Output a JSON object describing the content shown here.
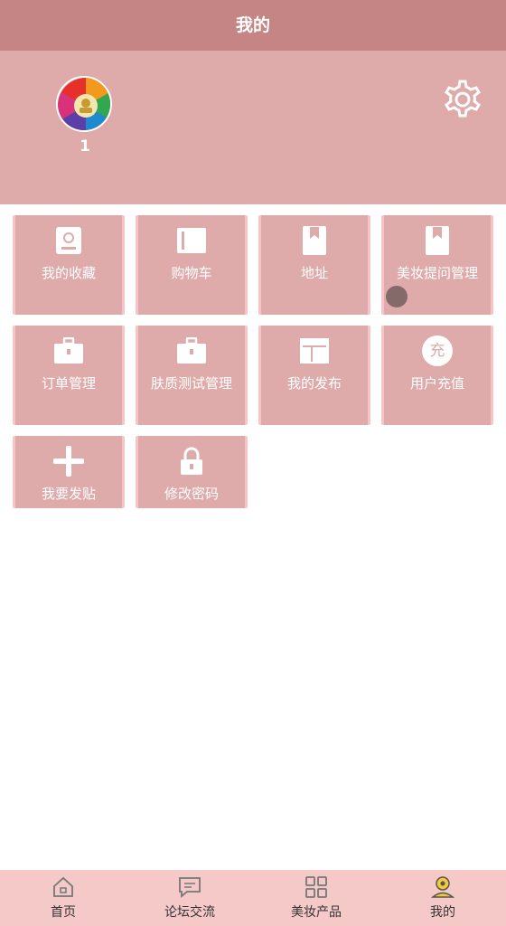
{
  "header": {
    "title": "我的"
  },
  "profile": {
    "username": "1"
  },
  "menu": [
    {
      "label": "我的收藏",
      "icon": "id-card-icon"
    },
    {
      "label": "购物车",
      "icon": "cart-icon"
    },
    {
      "label": "地址",
      "icon": "bookmark-icon"
    },
    {
      "label": "美妆提问管理",
      "icon": "bookmark-icon"
    },
    {
      "label": "订单管理",
      "icon": "briefcase-icon"
    },
    {
      "label": "肤质测试管理",
      "icon": "briefcase-icon"
    },
    {
      "label": "我的发布",
      "icon": "layout-icon"
    },
    {
      "label": "用户充值",
      "icon": "recharge-icon",
      "badge": "充"
    },
    {
      "label": "我要发贴",
      "icon": "plus-icon"
    },
    {
      "label": "修改密码",
      "icon": "lock-icon"
    }
  ],
  "tabs": [
    {
      "label": "首页",
      "icon": "home-icon"
    },
    {
      "label": "论坛交流",
      "icon": "chat-icon"
    },
    {
      "label": "美妆产品",
      "icon": "grid-icon"
    },
    {
      "label": "我的",
      "icon": "user-icon"
    }
  ],
  "colors": {
    "header": "#c58584",
    "profile_bg": "#dfabaa",
    "tile_bg": "#dfabaa",
    "tile_border": "#f6c6c6",
    "tabbar_bg": "#f6c9c9"
  }
}
